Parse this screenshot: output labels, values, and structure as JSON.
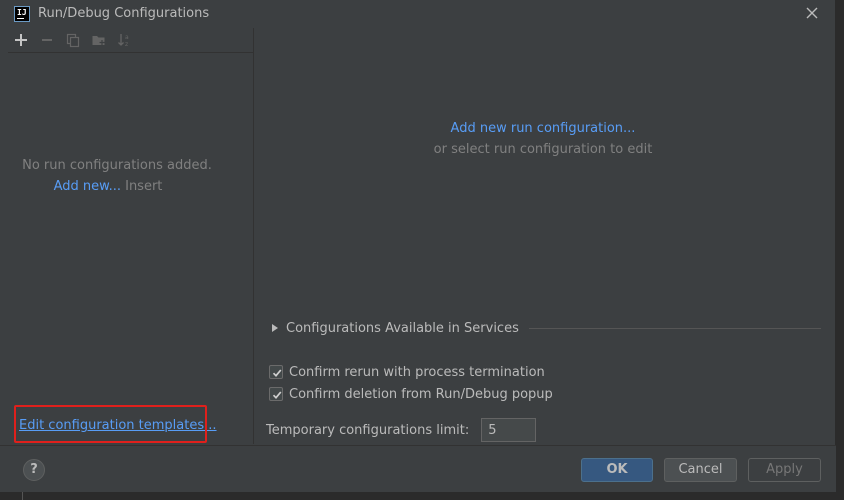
{
  "window": {
    "title": "Run/Debug Configurations",
    "app_icon": "intellij-icon",
    "app_icon_text": "IJ"
  },
  "left_panel": {
    "toolbar": [
      {
        "name": "add-icon",
        "enabled": true
      },
      {
        "name": "remove-icon",
        "enabled": false
      },
      {
        "name": "copy-icon",
        "enabled": false
      },
      {
        "name": "folder-icon",
        "enabled": false
      },
      {
        "name": "sort-icon",
        "enabled": false
      }
    ],
    "empty_message": "No run configurations added.",
    "add_new_link": "Add new...",
    "add_new_shortcut": "Insert",
    "edit_templates_link": "Edit configuration templates..."
  },
  "right_panel": {
    "add_config_link": "Add new run configuration...",
    "add_config_sub": "or select run configuration to edit",
    "services_label": "Configurations Available in Services",
    "services_expanded": false,
    "checkboxes": [
      {
        "label": "Confirm rerun with process termination",
        "checked": true
      },
      {
        "label": "Confirm deletion from Run/Debug popup",
        "checked": true
      }
    ],
    "limit_label": "Temporary configurations limit:",
    "limit_value": "5"
  },
  "buttons": {
    "help": "?",
    "ok": "OK",
    "cancel": "Cancel",
    "apply": "Apply"
  },
  "colors": {
    "background": "#3c3f41",
    "link": "#589df6",
    "highlight": "#e0201c",
    "ok_button": "#365880"
  }
}
